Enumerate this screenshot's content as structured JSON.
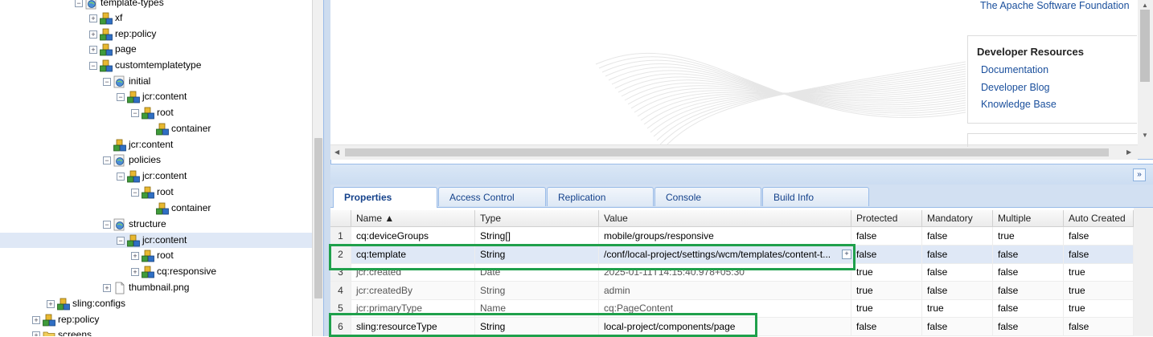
{
  "tree": {
    "nodes": [
      {
        "label": "template-types",
        "icon": "folder-globe-icon",
        "toggle": "−",
        "selected": false
      },
      {
        "label": "xf",
        "icon": "node-cubes-icon",
        "toggle": "+",
        "selected": false
      },
      {
        "label": "rep:policy",
        "icon": "node-cubes-icon",
        "toggle": "+",
        "selected": false
      },
      {
        "label": "page",
        "icon": "node-cubes-icon",
        "toggle": "+",
        "selected": false
      },
      {
        "label": "customtemplatetype",
        "icon": "node-cubes-icon",
        "toggle": "−",
        "selected": false
      },
      {
        "label": "initial",
        "icon": "page-globe-icon",
        "toggle": "−",
        "selected": false
      },
      {
        "label": "jcr:content",
        "icon": "node-cubes-icon",
        "toggle": "−",
        "selected": false
      },
      {
        "label": "root",
        "icon": "node-cubes-icon",
        "toggle": "−",
        "selected": false
      },
      {
        "label": "container",
        "icon": "node-cubes-icon",
        "toggle": "",
        "selected": false
      },
      {
        "label": "jcr:content",
        "icon": "node-cubes-icon",
        "toggle": "",
        "selected": false
      },
      {
        "label": "policies",
        "icon": "page-globe-icon",
        "toggle": "−",
        "selected": false
      },
      {
        "label": "jcr:content",
        "icon": "node-cubes-icon",
        "toggle": "−",
        "selected": false
      },
      {
        "label": "root",
        "icon": "node-cubes-icon",
        "toggle": "−",
        "selected": false
      },
      {
        "label": "container",
        "icon": "node-cubes-icon",
        "toggle": "",
        "selected": false
      },
      {
        "label": "structure",
        "icon": "page-globe-icon",
        "toggle": "−",
        "selected": false
      },
      {
        "label": "jcr:content",
        "icon": "node-cubes-icon",
        "toggle": "−",
        "selected": true
      },
      {
        "label": "root",
        "icon": "node-cubes-icon",
        "toggle": "+",
        "selected": false
      },
      {
        "label": "cq:responsive",
        "icon": "node-cubes-icon",
        "toggle": "+",
        "selected": false
      },
      {
        "label": "thumbnail.png",
        "icon": "file-icon",
        "toggle": "+",
        "selected": false
      },
      {
        "label": "sling:configs",
        "icon": "node-cubes-icon",
        "toggle": "+",
        "selected": false
      },
      {
        "label": "rep:policy",
        "icon": "node-cubes-icon",
        "toggle": "+",
        "selected": false
      },
      {
        "label": "screens",
        "icon": "folder-icon",
        "toggle": "+",
        "selected": false
      }
    ]
  },
  "welcome": {
    "apache_link": "The Apache Software Foundation",
    "dev_title": "Developer Resources",
    "dev_links": [
      "Documentation",
      "Developer Blog",
      "Knowledge Base"
    ]
  },
  "tabs": [
    "Properties",
    "Access Control",
    "Replication",
    "Console",
    "Build Info"
  ],
  "grid": {
    "columns": [
      "",
      "Name ▲",
      "Type",
      "Value",
      "Protected",
      "Mandatory",
      "Multiple",
      "Auto Created"
    ],
    "rows": [
      {
        "num": "1",
        "name": "cq:deviceGroups",
        "type": "String[]",
        "value": "mobile/groups/responsive",
        "protected": "false",
        "mandatory": "false",
        "multiple": "true",
        "auto": "false",
        "grey": false,
        "selected": false
      },
      {
        "num": "2",
        "name": "cq:template",
        "type": "String",
        "value": "/conf/local-project/settings/wcm/templates/content-t...",
        "protected": "false",
        "mandatory": "false",
        "multiple": "false",
        "auto": "false",
        "grey": false,
        "selected": true
      },
      {
        "num": "3",
        "name": "jcr:created",
        "type": "Date",
        "value": "2025-01-11T14:15:40.978+05:30",
        "protected": "true",
        "mandatory": "false",
        "multiple": "false",
        "auto": "true",
        "grey": true,
        "selected": false
      },
      {
        "num": "4",
        "name": "jcr:createdBy",
        "type": "String",
        "value": "admin",
        "protected": "true",
        "mandatory": "false",
        "multiple": "false",
        "auto": "true",
        "grey": true,
        "selected": false
      },
      {
        "num": "5",
        "name": "jcr:primaryType",
        "type": "Name",
        "value": "cq:PageContent",
        "protected": "true",
        "mandatory": "true",
        "multiple": "false",
        "auto": "true",
        "grey": true,
        "selected": false
      },
      {
        "num": "6",
        "name": "sling:resourceType",
        "type": "String",
        "value": "local-project/components/page",
        "protected": "false",
        "mandatory": "false",
        "multiple": "false",
        "auto": "false",
        "grey": false,
        "selected": false
      }
    ]
  },
  "colors": {
    "highlight": "#1fa04b",
    "selection": "#dfe8f6",
    "link": "#1a4f9c"
  }
}
